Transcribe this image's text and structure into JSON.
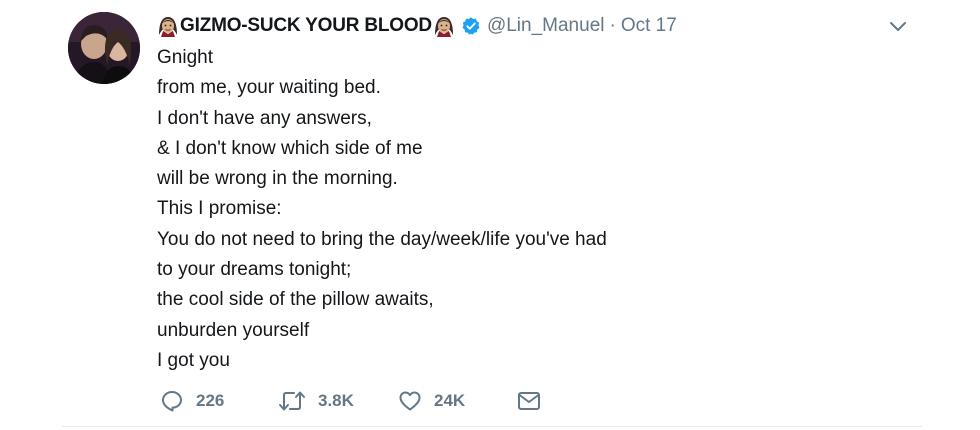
{
  "tweet": {
    "display_name": "GIZMO-SUCK YOUR BLOOD",
    "handle": "@Lin_Manuel",
    "separator": "·",
    "date": "Oct 17",
    "lines": [
      "Gnight",
      "from me, your waiting bed.",
      "I don't have any answers,",
      "& I don't know which side of me",
      "will be wrong in the morning.",
      "This I promise:",
      "You do not need to bring the day/week/life you've had",
      "to your dreams tonight;",
      "the cool side of the pillow awaits,",
      "unburden yourself",
      "I got you"
    ],
    "actions": {
      "replies": "226",
      "retweets": "3.8K",
      "likes": "24K"
    }
  },
  "icons": {
    "name_prefix": "vampire-emoji-icon",
    "name_suffix": "vampire-emoji-icon",
    "verified": "verified-badge-icon",
    "menu": "chevron-down-icon",
    "reply": "reply-icon",
    "retweet": "retweet-icon",
    "like": "heart-icon",
    "message": "envelope-icon"
  },
  "colors": {
    "text": "#14171a",
    "secondary": "#657786",
    "verified_blue": "#1da1f2",
    "divider": "#e6ecf0"
  }
}
